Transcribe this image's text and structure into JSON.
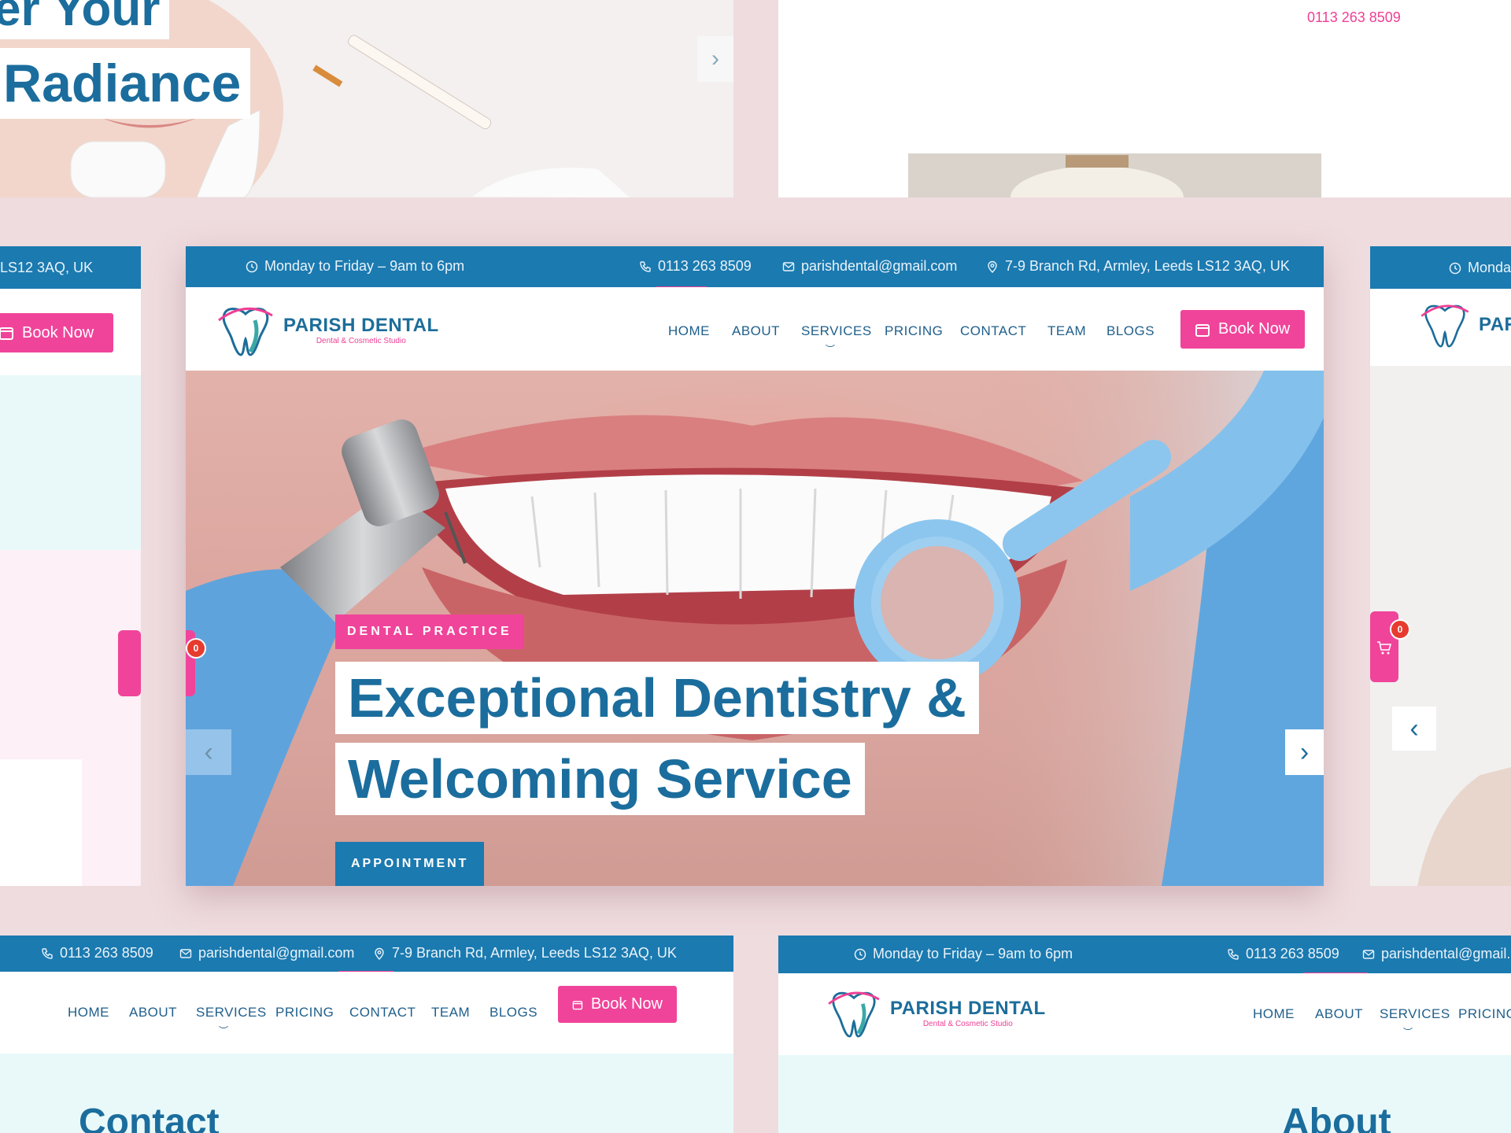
{
  "brand": {
    "name": "PARISH DENTAL",
    "tagline": "Dental & Cosmetic Studio"
  },
  "contact": {
    "hours": "Monday to Friday – 9am to 6pm",
    "phone": "0113 263 8509",
    "email": "parishdental@gmail.com",
    "address": "7-9 Branch Rd, Armley, Leeds LS12 3AQ, UK"
  },
  "nav": {
    "items": [
      "HOME",
      "ABOUT",
      "SERVICES",
      "PRICING",
      "CONTACT",
      "TEAM",
      "BLOGS"
    ],
    "book": "Book Now"
  },
  "hero": {
    "badge": "DENTAL PRACTICE",
    "line1": "Exceptional Dentistry &",
    "line2": "Welcoming Service",
    "cta": "APPOINTMENT"
  },
  "top_left": {
    "line1": "er Your",
    "line2": "Radiance"
  },
  "top_right": {
    "phone": "0113 263 8509"
  },
  "left_panel": {
    "address_fragment": "LS12 3AQ, UK",
    "book": "Book Now",
    "cart_count": "0"
  },
  "right_panel": {
    "hours_fragment": "Monday",
    "brand_fragment": "PAR",
    "cart_count": "0"
  },
  "bottom_left": {
    "phone": "0113 263 8509",
    "email": "parishdental@gmail.com",
    "address": "7-9 Branch Rd, Armley, Leeds LS12 3AQ, UK",
    "nav": [
      "HOME",
      "ABOUT",
      "SERVICES",
      "PRICING",
      "CONTACT",
      "TEAM",
      "BLOGS"
    ],
    "book": "Book Now",
    "heading": "Contact"
  },
  "bottom_right": {
    "hours": "Monday to Friday – 9am to 6pm",
    "phone": "0113 263 8509",
    "email": "parishdental@gmail.co",
    "nav": [
      "HOME",
      "ABOUT",
      "SERVICES",
      "PRICING"
    ],
    "heading": "About"
  },
  "main_cart_count": "0",
  "colors": {
    "primary": "#1b7ab0",
    "accent": "#f0449a",
    "heading": "#1b6d9d",
    "background": "#efdcdf"
  }
}
